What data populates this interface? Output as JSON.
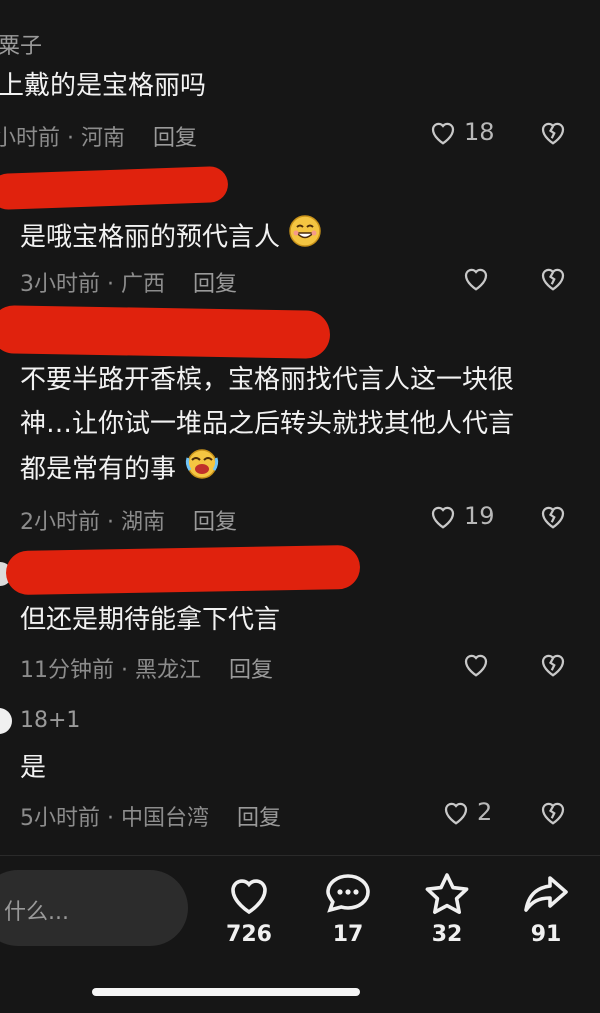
{
  "comments": [
    {
      "name": "粟子",
      "text": "上戴的是宝格丽吗",
      "meta": "小时前 · 河南",
      "reply": "回复",
      "likes": "18"
    },
    {
      "text": "是哦宝格丽的预代言人",
      "emoji": "smile-emoji",
      "meta": "3小时前 · 广西",
      "reply": "回复",
      "likes": ""
    },
    {
      "text_lines": [
        "不要半路开香槟，宝格丽找代言人这一块很",
        "神…让你试一堆品之后转头就找其他人代言",
        "都是常有的事"
      ],
      "emoji": "crying-laugh-emoji",
      "meta": "2小时前 · 湖南",
      "reply": "回复",
      "likes": "19"
    },
    {
      "text": "但还是期待能拿下代言",
      "meta": "11分钟前 · 黑龙江",
      "reply": "回复",
      "likes": ""
    },
    {
      "name": "18+1",
      "text": "是",
      "meta": "5小时前 · 中国台湾",
      "reply": "回复",
      "likes": "2"
    }
  ],
  "input": {
    "placeholder": "什么..."
  },
  "actions": [
    {
      "icon": "heart-icon",
      "count": "726"
    },
    {
      "icon": "comment-icon",
      "count": "17"
    },
    {
      "icon": "star-icon",
      "count": "32"
    },
    {
      "icon": "share-icon",
      "count": "91"
    }
  ],
  "colors": {
    "background": "#161616",
    "redaction": "#e0220d"
  }
}
